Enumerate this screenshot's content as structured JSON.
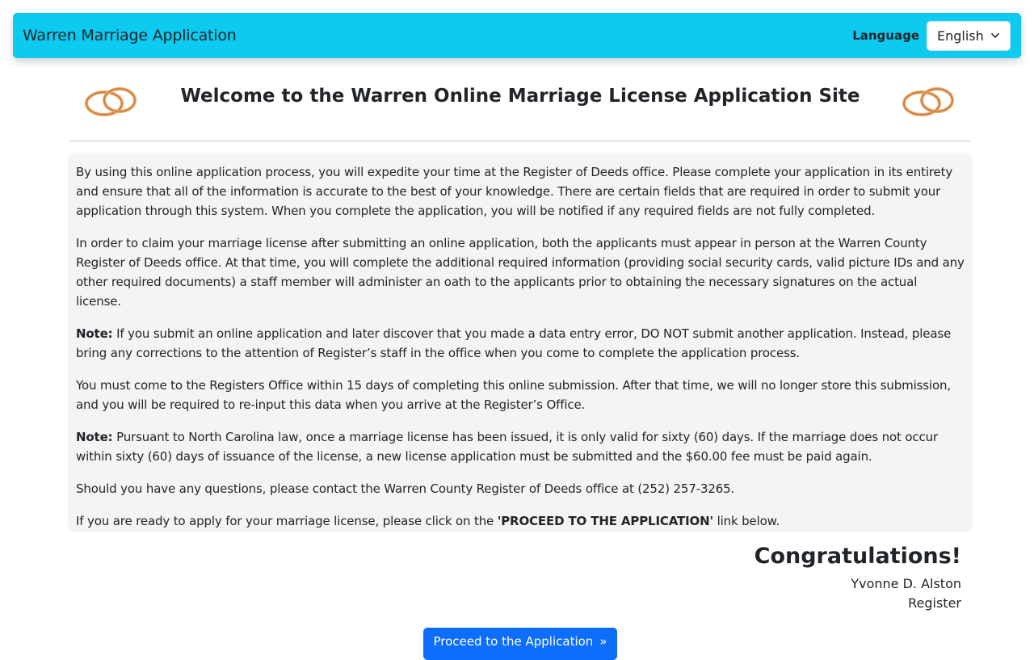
{
  "navbar": {
    "brand": "Warren Marriage Application",
    "language_label": "Language",
    "language_selected": "English"
  },
  "header": {
    "title": "Welcome to the Warren Online Marriage License Application Site"
  },
  "info": {
    "p1": "By using this online application process, you will expedite your time at the Register of Deeds office. Please complete your application in its entirety and ensure that all of the information is accurate to the best of your knowledge. There are certain fields that are required in order to submit your application through this system. When you complete the application, you will be notified if any required fields are not fully completed.",
    "p2": "In order to claim your marriage license after submitting an online application, both the applicants must appear in person at the Warren County Register of Deeds office. At that time, you will complete the additional required information (providing social security cards, valid picture IDs and any other required documents) a staff member will administer an oath to the applicants prior to obtaining the necessary signatures on the actual license.",
    "note_label": "Note:",
    "p3": " If you submit an online application and later discover that you made a data entry error, DO NOT submit another application. Instead, please bring any corrections to the attention of Register’s staff in the office when you come to complete the application process.",
    "p4": "You must come to the Registers Office within 15 days of completing this online submission. After that time, we will no longer store this submission, and you will be required to re-input this data when you arrive at the Register’s Office.",
    "p5": " Pursuant to North Carolina law, once a marriage license has been issued, it is only valid for sixty (60) days. If the marriage does not occur within sixty (60) days of issuance of the license, a new license application must be submitted and the $60.00 fee must be paid again.",
    "p6": "Should you have any questions, please contact the Warren County Register of Deeds office at (252) 257-3265.",
    "p7_before": "If you are ready to apply for your marriage license, please click on the ",
    "p7_bold": "'PROCEED TO THE APPLICATION'",
    "p7_after": " link below."
  },
  "congrats": {
    "heading": "Congratulations!",
    "name": "Yvonne D. Alston",
    "role": "Register"
  },
  "proceed": {
    "label": "Proceed to the Application",
    "arrow": "»"
  },
  "icons": {
    "language_dropdown": "chevron-down-icon",
    "decor": "wedding-rings-icon"
  },
  "colors": {
    "navbar": "#0dcaf0",
    "button": "#0d6efd",
    "info_bg": "#f4f4f4"
  }
}
